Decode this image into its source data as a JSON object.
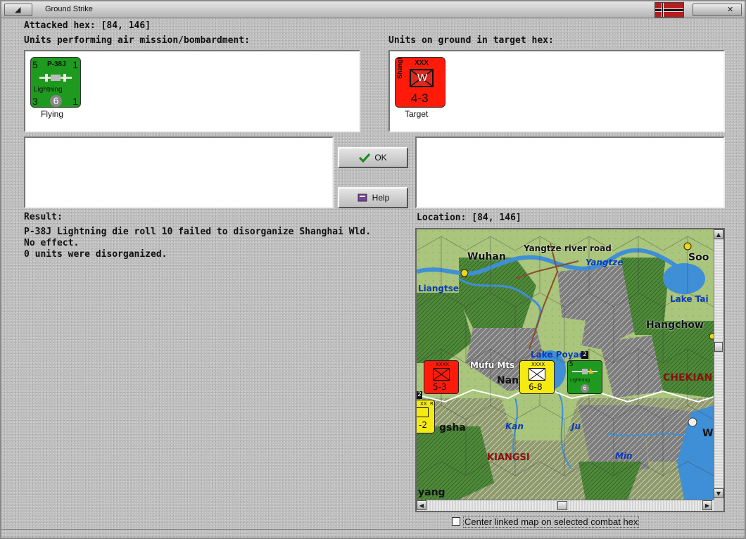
{
  "window": {
    "title": "Ground Strike",
    "left_button_glyph": "◢",
    "right_button_glyph": "✕"
  },
  "attacked_hex": {
    "label": "Attacked hex:",
    "value": "[84, 146]"
  },
  "air_units_panel": {
    "heading": "Units performing air mission/bombardment:",
    "units": [
      {
        "name": "P-38J",
        "type_label": "Lightning",
        "top_left": "5",
        "top_right": "1",
        "bottom_left": "3",
        "bottom_center": "6",
        "bottom_right": "1",
        "caption": "Flying",
        "color": "#1e9a1e"
      }
    ]
  },
  "ground_units_panel": {
    "heading": "Units on ground in target hex:",
    "units": [
      {
        "name": "Shanghai",
        "size": "XXX",
        "symbol": "W",
        "strength": "4-3",
        "caption": "Target",
        "color": "#ff1a0a"
      }
    ]
  },
  "buttons": {
    "ok": "OK",
    "help": "Help"
  },
  "result": {
    "heading": "Result:",
    "lines": [
      "P-38J Lightning die roll 10 failed to disorganize Shanghai Wld.",
      "No effect.",
      "0 units were disorganized."
    ]
  },
  "location": {
    "label": "Location:",
    "value": "[84, 146]"
  },
  "map": {
    "labels": {
      "wuhan": "Wuhan",
      "yangtze_road": "Yangtze river road",
      "yangtze": "Yangtze",
      "soochow": "Soo",
      "liangtse": "Liangtse",
      "lake_tai": "Lake Tai",
      "hangchow": "Hangchow",
      "lake_poyang": "Lake Poyan",
      "mufu": "Mufu Mts",
      "nan": "Nan",
      "chekiang": "CHEKIAN",
      "gsha": "gsha",
      "kan": "Kan",
      "ju": "Ju",
      "kiangsi": "KIANGSI",
      "min": "Min",
      "yang": "yang",
      "w": "W"
    },
    "counters": {
      "red": {
        "size": "XXXX",
        "strength": "5-3"
      },
      "yellow": {
        "size": "XXXX",
        "strength": "6-8"
      },
      "green": {
        "top_left": "5",
        "bottom_center": "6",
        "name": "Lightning",
        "stack": "2"
      },
      "left_yellow": {
        "size": "XX",
        "flag": "R",
        "strength": "-2",
        "stack": "2"
      }
    },
    "colors": {
      "forest": "#4f8a3a",
      "mountain": "#7b7b7b",
      "plain": "#a7c47a",
      "water": "#3f8fd6"
    }
  },
  "center_checkbox": {
    "label": "Center linked map on selected combat hex",
    "checked": false
  }
}
